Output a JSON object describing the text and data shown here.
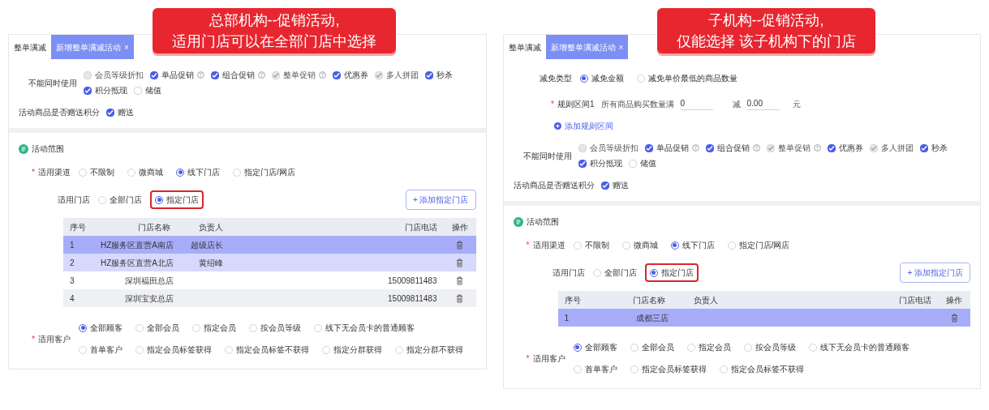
{
  "panels": [
    {
      "callout": [
        "总部机构--促销活动,",
        "适用门店可以在全部门店中选择"
      ],
      "tabs": [
        {
          "label": "整单满减",
          "selected": false
        },
        {
          "label": "新增整单满减活动",
          "close": "×",
          "selected": true
        }
      ],
      "exclusive": {
        "label": "不能同时使用",
        "options": [
          {
            "label": "会员等级折扣",
            "checked": false,
            "disabled": true,
            "help": false
          },
          {
            "label": "单品促销",
            "checked": true,
            "disabled": false,
            "help": true
          },
          {
            "label": "组合促销",
            "checked": true,
            "disabled": false,
            "help": true
          },
          {
            "label": "整单促销",
            "checked": true,
            "disabled": true,
            "help": true
          },
          {
            "label": "优惠券",
            "checked": true,
            "disabled": false,
            "help": false
          },
          {
            "label": "多人拼团",
            "checked": true,
            "disabled": true,
            "help": false
          },
          {
            "label": "秒杀",
            "checked": true,
            "disabled": false,
            "help": false
          },
          {
            "label": "积分抵现",
            "checked": true,
            "disabled": false,
            "help": false
          },
          {
            "label": "储值",
            "checked": false,
            "disabled": false,
            "help": false
          }
        ]
      },
      "points": {
        "label": "活动商品是否赠送积分",
        "option": {
          "label": "赠送",
          "checked": true
        }
      },
      "section_title": "活动范围",
      "channel": {
        "label": "适用渠道",
        "required": "*",
        "options": [
          {
            "label": "不限制",
            "selected": false
          },
          {
            "label": "微商城",
            "selected": false
          },
          {
            "label": "线下门店",
            "selected": true
          },
          {
            "label": "指定门店/网店",
            "selected": false
          }
        ]
      },
      "stores": {
        "label": "适用门店",
        "options": [
          {
            "label": "全部门店",
            "selected": false,
            "annotated": false
          },
          {
            "label": "指定门店",
            "selected": true,
            "annotated": true
          }
        ],
        "add_button": "+ 添加指定门店"
      },
      "table": {
        "columns": [
          "序号",
          "门店名称",
          "负责人",
          "门店电话",
          "操作"
        ],
        "rows": [
          {
            "no": "1",
            "name": "HZ服务区直营A南店",
            "manager": "超级店长",
            "selected": true,
            "hovered": false
          },
          {
            "no": "2",
            "name": "HZ服务区直营A北店",
            "manager": "黄绍峰",
            "selected": false,
            "hovered": true
          },
          {
            "no": "3",
            "name": "深圳福田总店",
            "phone": "15009811483",
            "selected": false,
            "hovered": false
          },
          {
            "no": "4",
            "name": "深圳宝安总店",
            "phone": "15009811483",
            "selected": false,
            "hovered": false
          }
        ]
      },
      "customers": {
        "label": "适用客户",
        "required": "*",
        "options": [
          {
            "label": "全部顾客",
            "selected": true
          },
          {
            "label": "全部会员",
            "selected": false
          },
          {
            "label": "指定会员",
            "selected": false
          },
          {
            "label": "按会员等级",
            "selected": false
          },
          {
            "label": "线下无会员卡的普通顾客",
            "selected": false
          },
          {
            "label": "首单客户",
            "selected": false
          },
          {
            "label": "指定会员标签获得",
            "selected": false
          },
          {
            "label": "指定会员标签不获得",
            "selected": false
          },
          {
            "label": "指定分群获得",
            "selected": false
          },
          {
            "label": "指定分群不获得",
            "selected": false
          }
        ]
      }
    },
    {
      "callout": [
        "子机构--促销活动,",
        "仅能选择 该子机构下的门店"
      ],
      "tabs": [
        {
          "label": "整单满减",
          "selected": false
        },
        {
          "label": "新增整单满减活动",
          "close": "×",
          "selected": true
        }
      ],
      "reduce_type": {
        "label": "减免类型",
        "options": [
          {
            "label": "减免金额",
            "selected": true
          },
          {
            "label": "减免单价最低的商品数量",
            "selected": false
          }
        ]
      },
      "rule": {
        "label": "规则区间1",
        "required": "*",
        "prefix": "所有商品购买数量满",
        "value": "0",
        "minus": "减",
        "amount": "0.00",
        "unit": "元"
      },
      "add_rule": "添加规则区间",
      "exclusive": {
        "label": "不能同时使用",
        "options": [
          {
            "label": "会员等级折扣",
            "checked": false,
            "disabled": true,
            "help": false
          },
          {
            "label": "单品促销",
            "checked": true,
            "disabled": false,
            "help": true
          },
          {
            "label": "组合促销",
            "checked": true,
            "disabled": false,
            "help": true
          },
          {
            "label": "整单促销",
            "checked": true,
            "disabled": true,
            "help": true
          },
          {
            "label": "优惠券",
            "checked": true,
            "disabled": false,
            "help": false
          },
          {
            "label": "多人拼团",
            "checked": true,
            "disabled": true,
            "help": false
          },
          {
            "label": "秒杀",
            "checked": true,
            "disabled": false,
            "help": false
          },
          {
            "label": "积分抵现",
            "checked": true,
            "disabled": false,
            "help": false
          },
          {
            "label": "储值",
            "checked": false,
            "disabled": false,
            "help": false
          }
        ]
      },
      "points": {
        "label": "活动商品是否赠送积分",
        "option": {
          "label": "赠送",
          "checked": true
        }
      },
      "section_title": "活动范围",
      "channel": {
        "label": "适用渠道",
        "required": "*",
        "options": [
          {
            "label": "不限制",
            "selected": false
          },
          {
            "label": "微商城",
            "selected": false
          },
          {
            "label": "线下门店",
            "selected": true
          },
          {
            "label": "指定门店/网店",
            "selected": false
          }
        ]
      },
      "stores": {
        "label": "适用门店",
        "options": [
          {
            "label": "全部门店",
            "selected": false,
            "annotated": false
          },
          {
            "label": "指定门店",
            "selected": true,
            "annotated": true
          }
        ],
        "add_button": "+ 添加指定门店"
      },
      "table": {
        "columns": [
          "序号",
          "门店名称",
          "负责人",
          "门店电话",
          "操作"
        ],
        "rows": [
          {
            "no": "1",
            "name": "成都三店",
            "selected": true,
            "hovered": false
          }
        ]
      },
      "customers": {
        "label": "适用客户",
        "required": "*",
        "options": [
          {
            "label": "全部顾客",
            "selected": true
          },
          {
            "label": "全部会员",
            "selected": false
          },
          {
            "label": "指定会员",
            "selected": false
          },
          {
            "label": "按会员等级",
            "selected": false
          },
          {
            "label": "线下无会员卡的普通顾客",
            "selected": false
          },
          {
            "label": "首单客户",
            "selected": false
          },
          {
            "label": "指定会员标签获得",
            "selected": false
          },
          {
            "label": "指定会员标签不获得",
            "selected": false
          }
        ]
      }
    }
  ]
}
